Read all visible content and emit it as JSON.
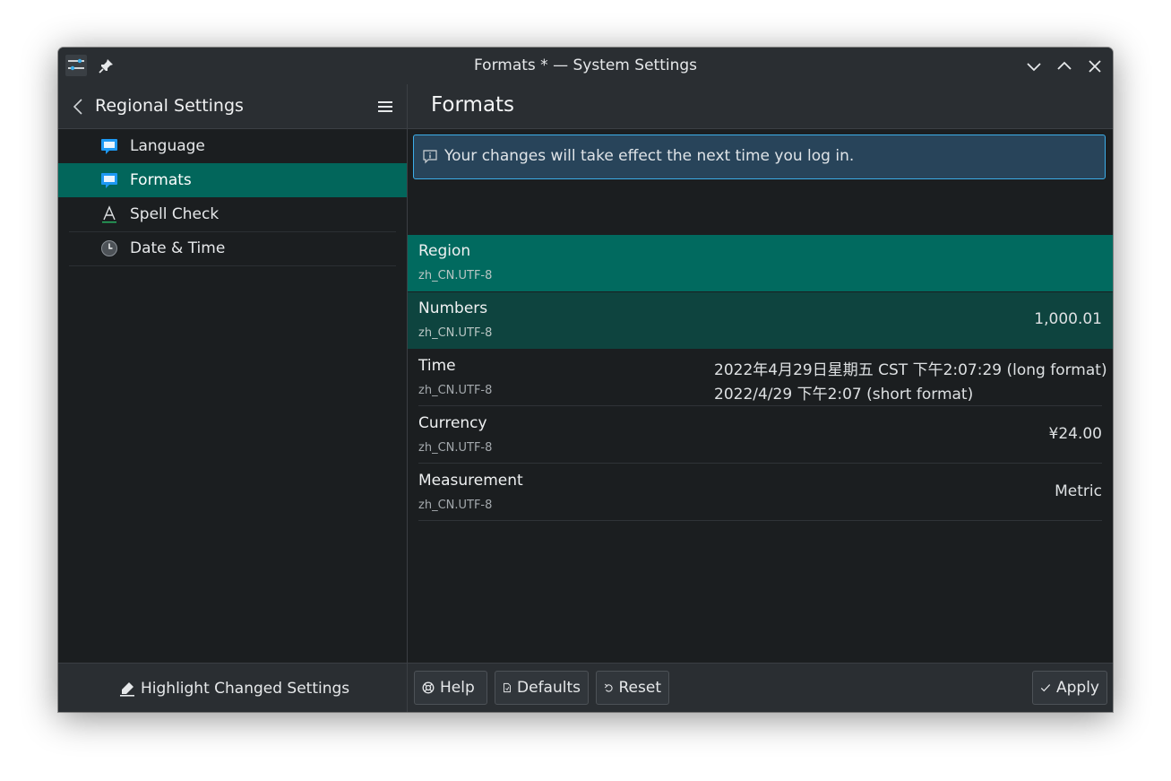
{
  "window": {
    "title": "Formats * — System Settings"
  },
  "sidebar": {
    "title": "Regional Settings",
    "items": [
      {
        "label": "Language",
        "icon": "chat-bubble-icon"
      },
      {
        "label": "Formats",
        "icon": "chat-bubble-icon",
        "active": true
      },
      {
        "label": "Spell Check",
        "icon": "spell-check-icon"
      },
      {
        "label": "Date & Time",
        "icon": "clock-icon"
      }
    ],
    "footer_button": "Highlight Changed Settings"
  },
  "main": {
    "title": "Formats",
    "info_message": "Your changes will take effect the next time you log in.",
    "rows": [
      {
        "title": "Region",
        "subtitle": "zh_CN.UTF-8",
        "value": ""
      },
      {
        "title": "Numbers",
        "subtitle": "zh_CN.UTF-8",
        "value": "1,000.01"
      },
      {
        "title": "Time",
        "subtitle": "zh_CN.UTF-8",
        "value_long": "2022年4月29日星期五 CST 下午2:07:29 (long format)",
        "value_short": "2022/4/29 下午2:07 (short format)"
      },
      {
        "title": "Currency",
        "subtitle": "zh_CN.UTF-8",
        "value": "¥24.00"
      },
      {
        "title": "Measurement",
        "subtitle": "zh_CN.UTF-8",
        "value": "Metric"
      }
    ],
    "buttons": {
      "help": "Help",
      "defaults": "Defaults",
      "reset": "Reset",
      "apply": "Apply"
    }
  },
  "colors": {
    "accent": "#02665b",
    "info_border": "#3daee9",
    "background": "#1b1e20",
    "header": "#2a2e32"
  }
}
